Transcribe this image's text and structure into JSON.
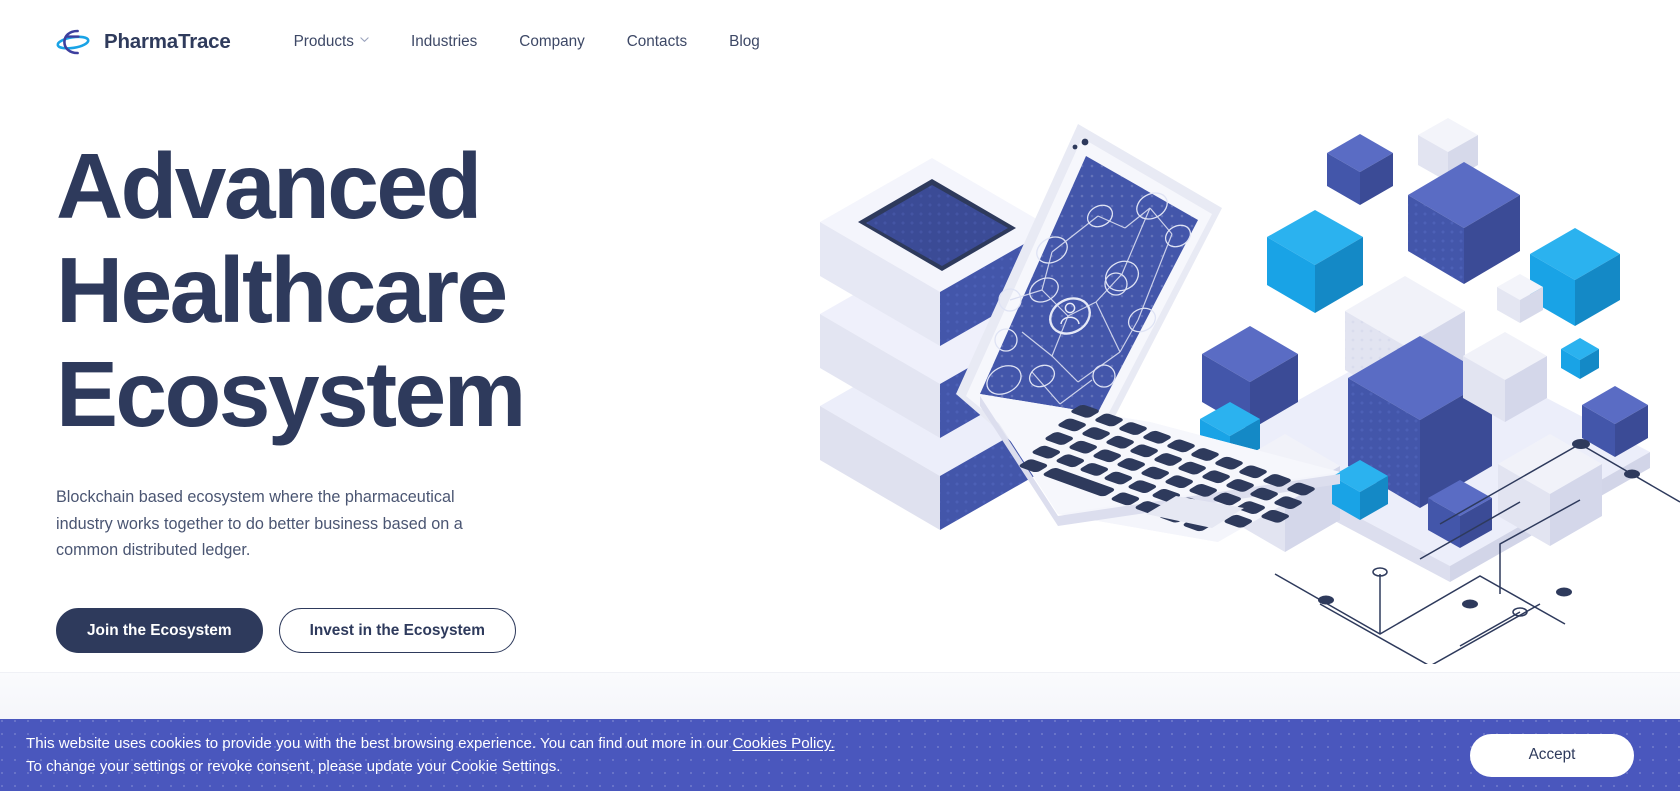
{
  "brand": {
    "name": "PharmaTrace",
    "logo_icon": "pharmatrace-atom-logo-icon",
    "logo_colors": {
      "arc": "#3d3f9e",
      "ellipse": "#1da1e8"
    }
  },
  "nav": {
    "items": [
      {
        "label": "Products",
        "has_dropdown": true,
        "icon": "chevron-down-icon"
      },
      {
        "label": "Industries",
        "has_dropdown": false
      },
      {
        "label": "Company",
        "has_dropdown": false
      },
      {
        "label": "Contacts",
        "has_dropdown": false
      },
      {
        "label": "Blog",
        "has_dropdown": false
      }
    ]
  },
  "hero": {
    "title": "Advanced Healthcare Ecosystem",
    "title_lines": [
      "Advanced",
      "Healthcare",
      "Ecosystem"
    ],
    "subtitle": "Blockchain based ecosystem where the pharmaceutical industry works together to do better business based on a common distributed ledger.",
    "primary_cta": "Join the Ecosystem",
    "secondary_cta": "Invest in the Ecosystem",
    "illustration": {
      "name": "isometric-blockchain-illustration",
      "elements": [
        "server-stack",
        "laptop-with-network-diagram",
        "floating-cubes-platform",
        "circuit-traces"
      ],
      "colors": {
        "indigo": "#4356aa",
        "indigo_dark": "#3b4b96",
        "indigo_light": "#5a6cc4",
        "cyan": "#19a3e6",
        "cyan_dark": "#1489c6",
        "lavender": "#dcdeee",
        "lavender_light": "#eceefa",
        "white": "#f7f8fc",
        "navy": "#2e3a5c"
      }
    }
  },
  "cookie_banner": {
    "line1_before_link": "This website uses cookies to provide you with the best browsing experience. You can find out more in our ",
    "link_text": "Cookies Policy.",
    "line2": "To change your settings or revoke consent, please update your Cookie Settings.",
    "accept_label": "Accept",
    "background_color": "#4a57bd",
    "text_color": "#ffffff"
  },
  "theme": {
    "heading_color": "#2e3a5c",
    "body_text_color": "#4a5572",
    "nav_text_color": "#3d4866",
    "accent_indigo": "#4a57bd",
    "accent_cyan": "#19a3e6",
    "page_background": "#ffffff"
  }
}
